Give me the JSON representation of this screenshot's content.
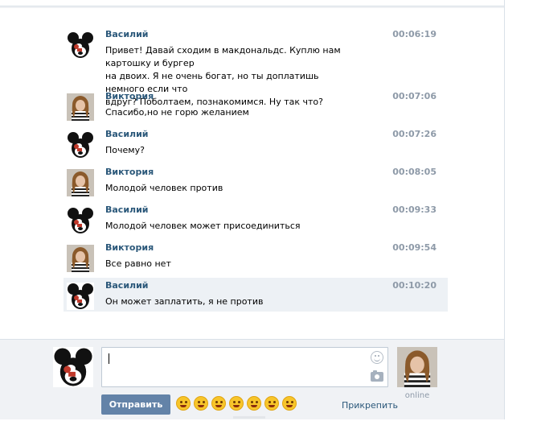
{
  "messages": [
    {
      "author": "Василий",
      "time": "00:06:19",
      "lines": [
        "Привет! Давай сходим в макдональдс. Куплю нам картошку и бургер",
        "на двоих. Я не очень богат, но ты доплатишь немного если что",
        "вдруг? Поболтаем, познакомимся. Ну так что?"
      ],
      "avatar": "mickey-avatar-icon"
    },
    {
      "author": "Виктория",
      "time": "00:07:06",
      "lines": [
        "Спасибо,но не горю желанием"
      ],
      "avatar": "woman-avatar-icon"
    },
    {
      "author": "Василий",
      "time": "00:07:26",
      "lines": [
        "Почему?"
      ],
      "avatar": "mickey-avatar-icon"
    },
    {
      "author": "Виктория",
      "time": "00:08:05",
      "lines": [
        "Молодой человек против"
      ],
      "avatar": "woman-avatar-icon"
    },
    {
      "author": "Василий",
      "time": "00:09:33",
      "lines": [
        "Молодой человек может присоединиться"
      ],
      "avatar": "mickey-avatar-icon"
    },
    {
      "author": "Виктория",
      "time": "00:09:54",
      "lines": [
        "Все равно нет"
      ],
      "avatar": "woman-avatar-icon"
    },
    {
      "author": "Василий",
      "time": "00:10:20",
      "lines": [
        "Он может заплатить, я не против"
      ],
      "avatar": "mickey-avatar-icon",
      "highlighted": true
    }
  ],
  "composer": {
    "send_label": "Отправить",
    "attach_label": "Прикрепить",
    "input_value": "",
    "emoji_icons": [
      "smile-emoji-icon",
      "shocked-emoji-icon",
      "grin-emoji-icon",
      "tired-emoji-icon",
      "laughing-emoji-icon",
      "happy-emoji-icon",
      "tears-of-joy-emoji-icon"
    ]
  },
  "partner": {
    "status": "online"
  },
  "colors": {
    "author": "#2b587a",
    "time": "#8e9aa8",
    "send_button": "#6383a8",
    "highlight_row": "#edf1f5",
    "composer_bg": "#f0f2f5"
  }
}
